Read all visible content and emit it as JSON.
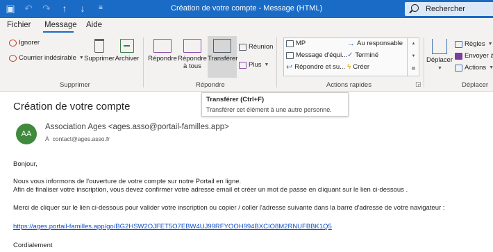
{
  "titlebar": {
    "title": "Création de votre compte  -  Message (HTML)",
    "search_placeholder": "Rechercher",
    "accent_color": "#1a6bc6"
  },
  "menu": {
    "tabs": [
      {
        "label": "Fichier"
      },
      {
        "label": "Message",
        "active": true
      },
      {
        "label": "Aide"
      }
    ]
  },
  "ribbon": {
    "delete_group": {
      "label": "Supprimer",
      "ignore": "Ignorer",
      "junk": "Courrier indésirable",
      "delete": "Supprimer",
      "archive": "Archiver"
    },
    "respond_group": {
      "label": "Répondre",
      "reply": "Répondre",
      "reply_all_1": "Répondre",
      "reply_all_2": "à tous",
      "forward": "Transférer",
      "meeting": "Réunion",
      "more": "Plus"
    },
    "quick_steps": {
      "label": "Actions rapides",
      "items": [
        "MP",
        "Au responsable",
        "Message d'équi...",
        "Terminé",
        "Répondre et su...",
        "Créer"
      ]
    },
    "move_group": {
      "label": "Déplacer",
      "move": "Déplacer",
      "rules": "Règles",
      "send_to": "Envoyer à O",
      "actions": "Actions"
    }
  },
  "tooltip": {
    "title": "Transférer (Ctrl+F)",
    "description": "Transférer cet élément à une autre personne."
  },
  "message": {
    "subject": "Création de votre compte",
    "avatar_initials": "AA",
    "avatar_color": "#3f8a3c",
    "sender": "Association Ages <ages.asso@portail-familles.app>",
    "to_label": "À",
    "to": "contact@ages.asso.fr",
    "greeting": "Bonjour,",
    "line1": "Nous vous informons de l'ouverture de votre compte sur notre Portail en ligne.",
    "line2": "Afin de finaliser votre inscription, vous devez confirmer votre adresse email et créer un mot de passe en cliquant sur le lien ci-dessous .",
    "line3": "Merci de cliquer sur le lien ci-dessous pour valider votre inscription ou copier / coller l'adresse suivante dans la barre d'adresse de votre navigateur :",
    "link": "https://ages.portail-familles.app/go/BG2HSW2OJFET5O7EBW4UJ99RFYOOH994BXCIO8M2RNUFBBK1Q5",
    "closing": "Cordialement"
  }
}
